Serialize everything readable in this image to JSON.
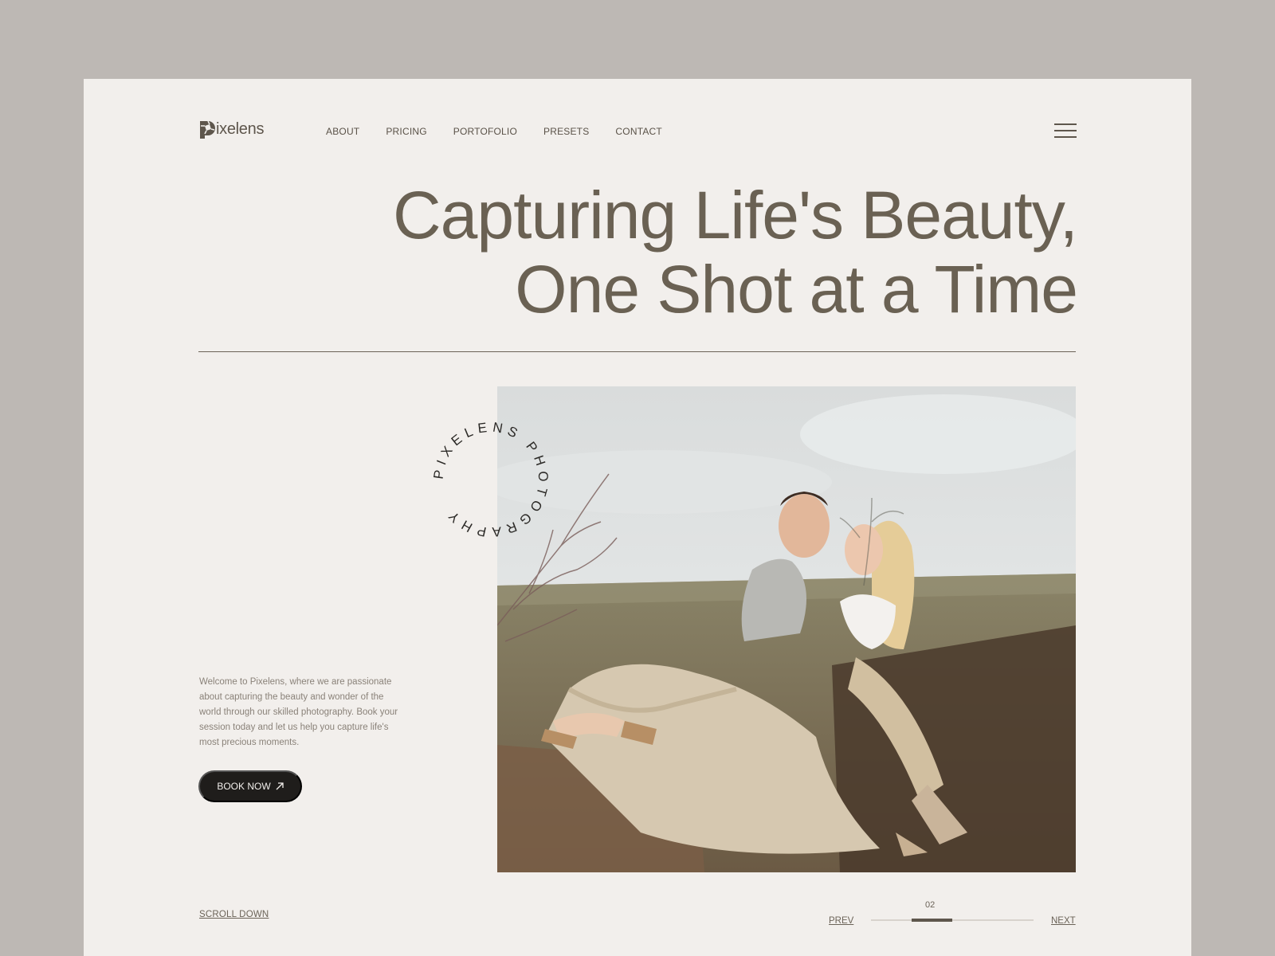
{
  "brand": {
    "name": "ixelens",
    "logo_icon": "aperture-p-icon"
  },
  "nav": {
    "items": [
      "ABOUT",
      "PRICING",
      "PORTOFOLIO",
      "PRESETS",
      "CONTACT"
    ]
  },
  "menu_icon": "hamburger-icon",
  "hero": {
    "title_line1": "Capturing Life's Beauty,",
    "title_line2": "One Shot at a Time"
  },
  "badge_text": "PIXELENS PHOTOGRAPHY",
  "intro": "Welcome to Pixelens, where we are passionate about capturing the beauty and wonder of the world through our skilled photography. Book your session today and let us help you capture life's most precious moments.",
  "cta": {
    "label": "BOOK NOW",
    "icon": "arrow-up-right-icon"
  },
  "scroll_label": "SCROLL DOWN",
  "slider": {
    "current": "02",
    "prev_label": "PREV",
    "next_label": "NEXT",
    "position": 0.25,
    "segment": 0.25
  },
  "colors": {
    "background": "#bdb8b4",
    "page": "#f2efec",
    "text": "#6b6358",
    "button": "#1f1d1b"
  }
}
